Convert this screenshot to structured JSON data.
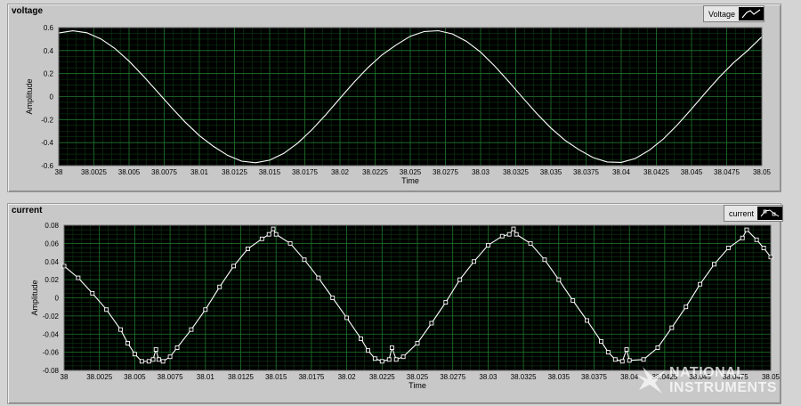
{
  "chart_data": [
    {
      "type": "line",
      "title": "voltage",
      "xlabel": "Time",
      "ylabel": "Amplitude",
      "legend": "Voltage",
      "legend_placement": "top-right",
      "xlim": [
        38,
        38.05
      ],
      "ylim": [
        -0.6,
        0.6
      ],
      "xticks": [
        "38",
        "38.0025",
        "38.005",
        "38.0075",
        "38.01",
        "38.0125",
        "38.015",
        "38.0175",
        "38.02",
        "38.0225",
        "38.025",
        "38.0275",
        "38.03",
        "38.0325",
        "38.035",
        "38.0375",
        "38.04",
        "38.0425",
        "38.045",
        "38.0475",
        "38.05"
      ],
      "yticks": [
        "0.6",
        "0.4",
        "0.2",
        "0",
        "-0.2",
        "-0.4",
        "-0.6"
      ],
      "grid": true,
      "line_color": "#ffffff",
      "series": [
        {
          "points": [
            [
              38.0,
              0.553
            ],
            [
              38.001,
              0.572
            ],
            [
              38.002,
              0.555
            ],
            [
              38.003,
              0.502
            ],
            [
              38.004,
              0.418
            ],
            [
              38.005,
              0.308
            ],
            [
              38.006,
              0.181
            ],
            [
              38.007,
              0.045
            ],
            [
              38.008,
              -0.092
            ],
            [
              38.009,
              -0.223
            ],
            [
              38.01,
              -0.339
            ],
            [
              38.011,
              -0.433
            ],
            [
              38.012,
              -0.51
            ],
            [
              38.013,
              -0.561
            ],
            [
              38.014,
              -0.575
            ],
            [
              38.015,
              -0.553
            ],
            [
              38.016,
              -0.494
            ],
            [
              38.017,
              -0.404
            ],
            [
              38.018,
              -0.289
            ],
            [
              38.019,
              -0.156
            ],
            [
              38.02,
              -0.015
            ],
            [
              38.021,
              0.125
            ],
            [
              38.022,
              0.253
            ],
            [
              38.023,
              0.364
            ],
            [
              38.024,
              0.45
            ],
            [
              38.025,
              0.525
            ],
            [
              38.026,
              0.566
            ],
            [
              38.027,
              0.573
            ],
            [
              38.028,
              0.545
            ],
            [
              38.029,
              0.48
            ],
            [
              38.03,
              0.386
            ],
            [
              38.031,
              0.266
            ],
            [
              38.032,
              0.131
            ],
            [
              38.033,
              -0.01
            ],
            [
              38.034,
              -0.148
            ],
            [
              38.035,
              -0.273
            ],
            [
              38.036,
              -0.38
            ],
            [
              38.037,
              -0.462
            ],
            [
              38.038,
              -0.53
            ],
            [
              38.039,
              -0.568
            ],
            [
              38.04,
              -0.572
            ],
            [
              38.041,
              -0.538
            ],
            [
              38.042,
              -0.466
            ],
            [
              38.043,
              -0.368
            ],
            [
              38.044,
              -0.245
            ],
            [
              38.045,
              -0.108
            ],
            [
              38.046,
              0.035
            ],
            [
              38.047,
              0.173
            ],
            [
              38.048,
              0.296
            ],
            [
              38.049,
              0.401
            ],
            [
              38.05,
              0.52
            ]
          ]
        }
      ]
    },
    {
      "type": "line",
      "title": "current",
      "xlabel": "Time",
      "ylabel": "Amplitude",
      "legend": "current",
      "legend_placement": "top-right",
      "xlim": [
        38,
        38.05
      ],
      "ylim": [
        -0.08,
        0.08
      ],
      "xticks": [
        "38",
        "38.0025",
        "38.005",
        "38.0075",
        "38.01",
        "38.0125",
        "38.015",
        "38.0175",
        "38.02",
        "38.0225",
        "38.025",
        "38.0275",
        "38.03",
        "38.0325",
        "38.035",
        "38.0375",
        "38.04",
        "38.0425",
        "38.045",
        "38.0475",
        "38.05"
      ],
      "yticks": [
        "0.08",
        "0.06",
        "0.04",
        "0.02",
        "0",
        "-0.02",
        "-0.04",
        "-0.06",
        "-0.08"
      ],
      "grid": true,
      "line_color": "#ffffff",
      "marker": "square",
      "series": [
        {
          "points": [
            [
              38.0,
              0.035
            ],
            [
              38.001,
              0.022
            ],
            [
              38.002,
              0.005
            ],
            [
              38.003,
              -0.013
            ],
            [
              38.004,
              -0.035
            ],
            [
              38.0045,
              -0.05
            ],
            [
              38.005,
              -0.062
            ],
            [
              38.0055,
              -0.07
            ],
            [
              38.006,
              -0.07
            ],
            [
              38.0063,
              -0.068
            ],
            [
              38.0065,
              -0.057
            ],
            [
              38.0067,
              -0.068
            ],
            [
              38.007,
              -0.07
            ],
            [
              38.0075,
              -0.065
            ],
            [
              38.008,
              -0.055
            ],
            [
              38.009,
              -0.035
            ],
            [
              38.01,
              -0.013
            ],
            [
              38.011,
              0.012
            ],
            [
              38.012,
              0.035
            ],
            [
              38.013,
              0.054
            ],
            [
              38.014,
              0.065
            ],
            [
              38.0145,
              0.07
            ],
            [
              38.0148,
              0.076
            ],
            [
              38.015,
              0.07
            ],
            [
              38.016,
              0.06
            ],
            [
              38.017,
              0.042
            ],
            [
              38.018,
              0.022
            ],
            [
              38.019,
              0.0
            ],
            [
              38.02,
              -0.022
            ],
            [
              38.021,
              -0.045
            ],
            [
              38.0215,
              -0.058
            ],
            [
              38.022,
              -0.067
            ],
            [
              38.0225,
              -0.07
            ],
            [
              38.023,
              -0.068
            ],
            [
              38.0232,
              -0.055
            ],
            [
              38.0235,
              -0.068
            ],
            [
              38.024,
              -0.065
            ],
            [
              38.025,
              -0.05
            ],
            [
              38.026,
              -0.028
            ],
            [
              38.027,
              -0.005
            ],
            [
              38.028,
              0.02
            ],
            [
              38.029,
              0.04
            ],
            [
              38.03,
              0.058
            ],
            [
              38.031,
              0.068
            ],
            [
              38.0315,
              0.07
            ],
            [
              38.0318,
              0.076
            ],
            [
              38.032,
              0.07
            ],
            [
              38.033,
              0.06
            ],
            [
              38.034,
              0.042
            ],
            [
              38.035,
              0.02
            ],
            [
              38.036,
              -0.003
            ],
            [
              38.037,
              -0.025
            ],
            [
              38.038,
              -0.048
            ],
            [
              38.0385,
              -0.06
            ],
            [
              38.039,
              -0.068
            ],
            [
              38.0395,
              -0.07
            ],
            [
              38.0398,
              -0.057
            ],
            [
              38.04,
              -0.069
            ],
            [
              38.041,
              -0.068
            ],
            [
              38.042,
              -0.055
            ],
            [
              38.043,
              -0.033
            ],
            [
              38.044,
              -0.01
            ],
            [
              38.045,
              0.015
            ],
            [
              38.046,
              0.037
            ],
            [
              38.047,
              0.055
            ],
            [
              38.048,
              0.066
            ],
            [
              38.0483,
              0.075
            ],
            [
              38.049,
              0.064
            ],
            [
              38.0495,
              0.055
            ],
            [
              38.05,
              0.045
            ]
          ]
        }
      ]
    }
  ],
  "watermark": {
    "line1": "NATIONAL",
    "line2": "INSTRUMENTS"
  }
}
